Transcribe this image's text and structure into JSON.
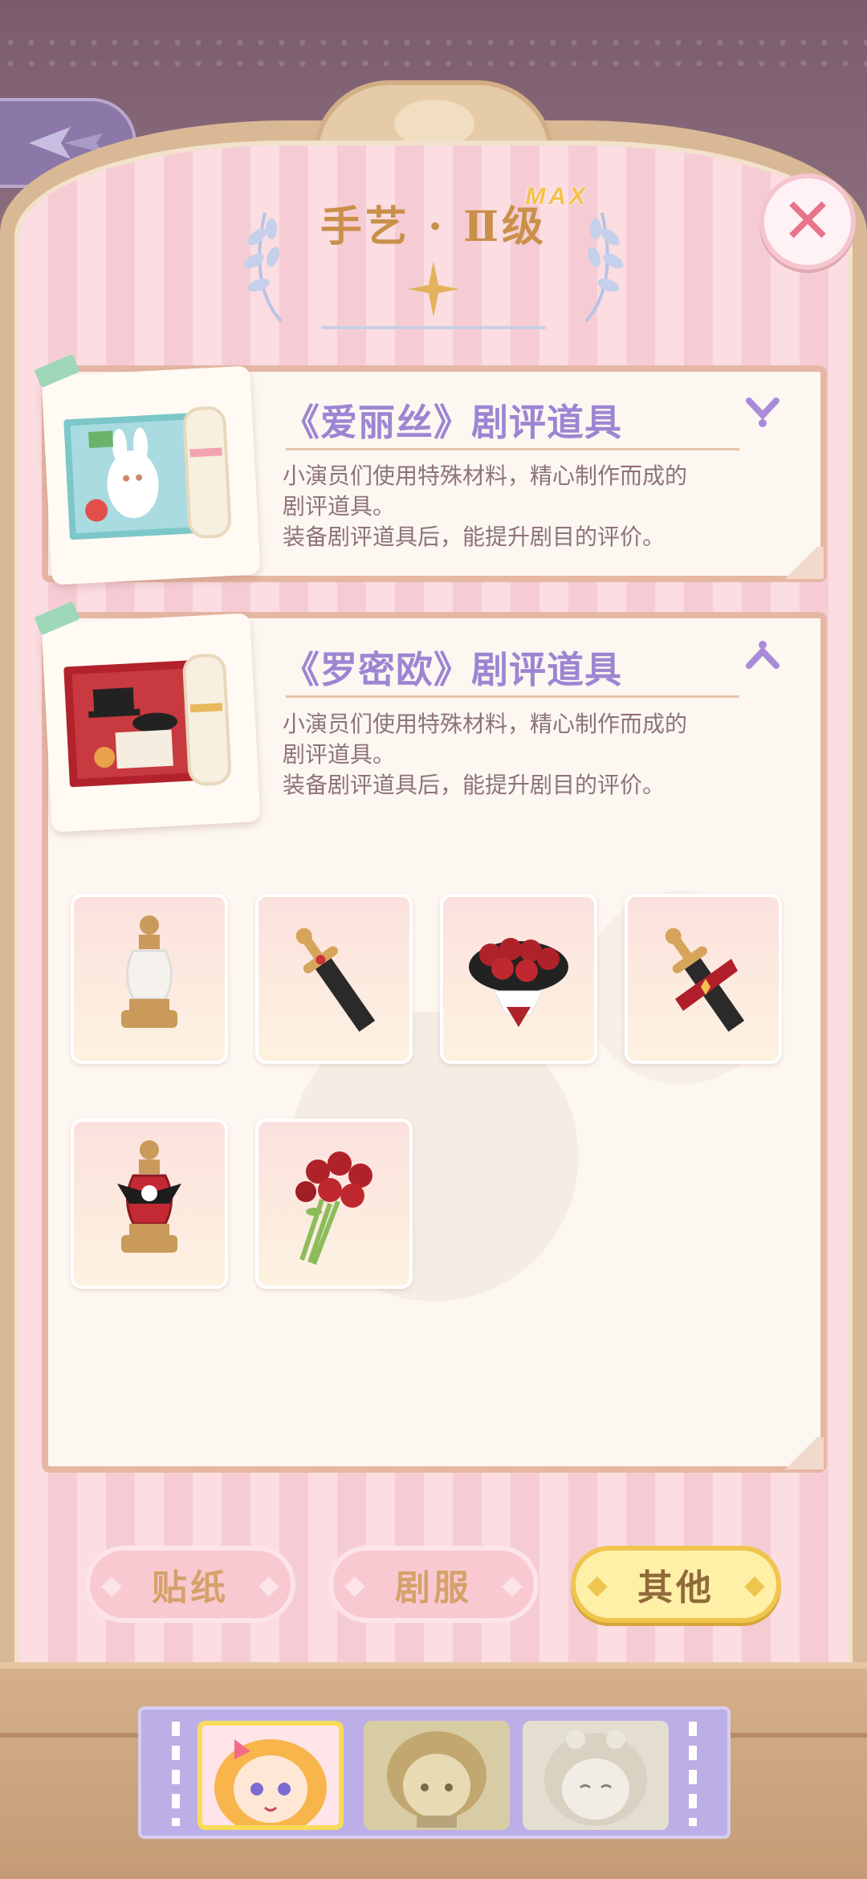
{
  "header": {
    "title": "手艺 · Ⅱ级",
    "max_badge": "MAX"
  },
  "cards": [
    {
      "title": "《爱丽丝》剧评道具",
      "desc_line1": "小演员们使用特殊材料，精心制作而成的",
      "desc_line2": "剧评道具。",
      "desc_line3": "装备剧评道具后，能提升剧目的评价。",
      "state": "collapsed"
    },
    {
      "title": "《罗密欧》剧评道具",
      "desc_line1": "小演员们使用特殊材料，精心制作而成的",
      "desc_line2": "剧评道具。",
      "desc_line3": "装备剧评道具后，能提升剧目的评价。",
      "state": "expanded",
      "items": [
        "potion-bottle-icon",
        "sword-icon",
        "rose-bouquet-icon",
        "sword-ribbon-icon",
        "skull-potion-icon",
        "rose-bunch-icon"
      ]
    }
  ],
  "tabs": [
    {
      "label": "贴纸",
      "active": false
    },
    {
      "label": "剧服",
      "active": false
    },
    {
      "label": "其他",
      "active": true
    }
  ],
  "colors": {
    "accent_purple": "#9c86d2",
    "title_gold": "#c9904a",
    "active_tab": "#fff0a8",
    "close_red": "#e8738b"
  }
}
